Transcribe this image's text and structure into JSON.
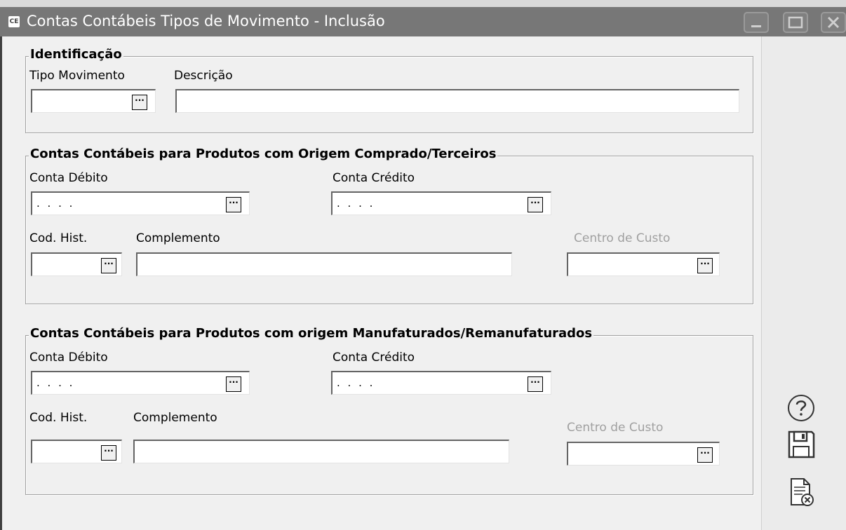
{
  "window": {
    "app_icon_text": "CE",
    "title": "Contas Contábeis Tipos de Movimento - Inclusão"
  },
  "identificacao": {
    "legend": "Identificação",
    "tipo_movimento_label": "Tipo Movimento",
    "descricao_label": "Descrição",
    "tipo_movimento_value": "",
    "descricao_value": ""
  },
  "comprado": {
    "legend": "Contas Contábeis para Produtos com Origem Comprado/Terceiros",
    "conta_debito_label": "Conta Débito",
    "conta_debito_value": ". . . .",
    "conta_credito_label": "Conta Crédito",
    "conta_credito_value": ". . . .",
    "cod_hist_label": "Cod. Hist.",
    "complemento_label": "Complemento",
    "centro_custo_label": "Centro de Custo"
  },
  "manufaturado": {
    "legend": "Contas Contábeis para Produtos com origem Manufaturados/Remanufaturados",
    "conta_debito_label": "Conta Débito",
    "conta_debito_value": ". . . .",
    "conta_credito_label": "Conta Crédito",
    "conta_credito_value": ". . . .",
    "cod_hist_label": "Cod. Hist.",
    "complemento_label": "Complemento",
    "centro_custo_label": "Centro de Custo"
  },
  "lookup_button_glyph": "···",
  "side_actions": {
    "help_icon": "help-icon",
    "save_icon": "save-icon",
    "cancel_icon": "cancel-document-icon"
  },
  "colors": {
    "titlebar": "#777777",
    "disabled_text": "#a0a0a0"
  }
}
